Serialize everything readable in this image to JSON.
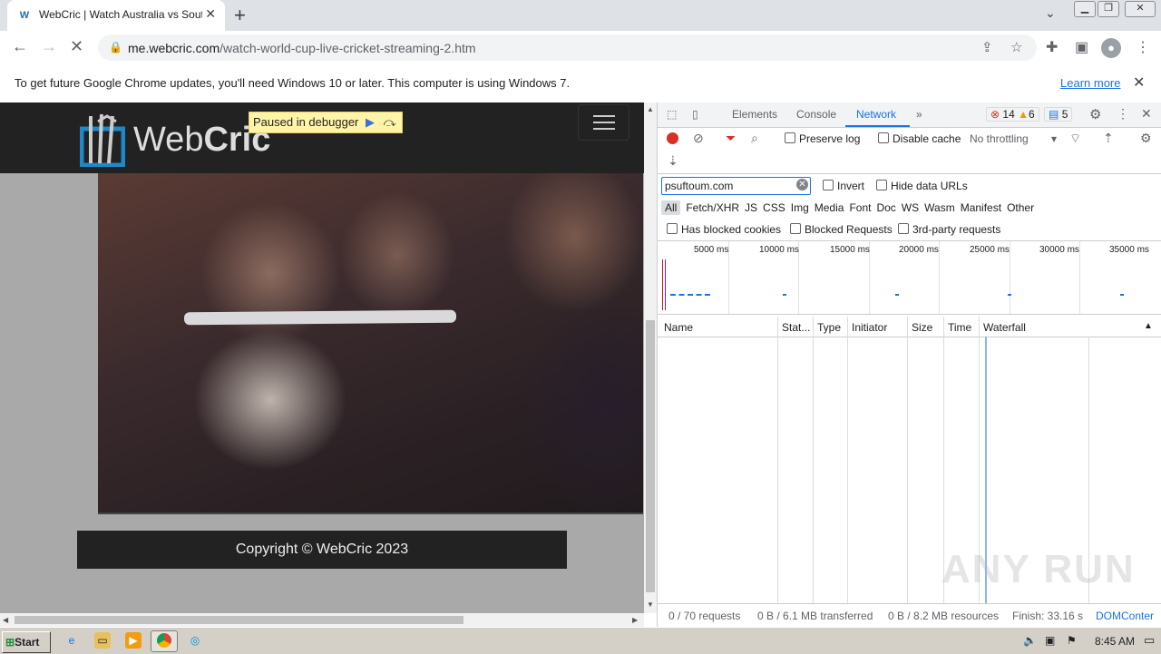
{
  "browser": {
    "tab_title": "WebCric | Watch Australia vs South",
    "tab_favicon": "W",
    "url_host": "me.webcric.com",
    "url_path": "/watch-world-cup-live-cricket-streaming-2.htm"
  },
  "infobar": {
    "message": "To get future Google Chrome updates, you'll need Windows 10 or later. This computer is using Windows 7.",
    "learn_more": "Learn more"
  },
  "site": {
    "logo_text_light": "Web",
    "logo_text_bold": "Cric",
    "debugger_badge": "Paused in debugger",
    "footer_text": "Copyright © WebCric 2023"
  },
  "devtools": {
    "tabs": [
      "Elements",
      "Console",
      "Network"
    ],
    "more": "»",
    "errors": "14",
    "warnings": "6",
    "messages": "5",
    "preserve_log": "Preserve log",
    "disable_cache": "Disable cache",
    "throttling": "No throttling",
    "filter_value": "psuftoum.com",
    "invert": "Invert",
    "hide_data_urls": "Hide data URLs",
    "types": [
      "All",
      "Fetch/XHR",
      "JS",
      "CSS",
      "Img",
      "Media",
      "Font",
      "Doc",
      "WS",
      "Wasm",
      "Manifest",
      "Other"
    ],
    "has_blocked_cookies": "Has blocked cookies",
    "blocked_requests": "Blocked Requests",
    "third_party": "3rd-party requests",
    "timeline_ticks": [
      "5000 ms",
      "10000 ms",
      "15000 ms",
      "20000 ms",
      "25000 ms",
      "30000 ms",
      "35000 ms"
    ],
    "columns": [
      "Name",
      "Stat...",
      "Type",
      "Initiator",
      "Size",
      "Time",
      "Waterfall"
    ],
    "status": {
      "requests": "0 / 70 requests",
      "transferred": "0 B / 6.1 MB transferred",
      "resources": "0 B / 8.2 MB resources",
      "finish": "Finish: 33.16 s",
      "domcontent": "DOMConter"
    }
  },
  "taskbar": {
    "start": "Start",
    "clock": "8:45 AM"
  },
  "watermark": "ANY RUN"
}
